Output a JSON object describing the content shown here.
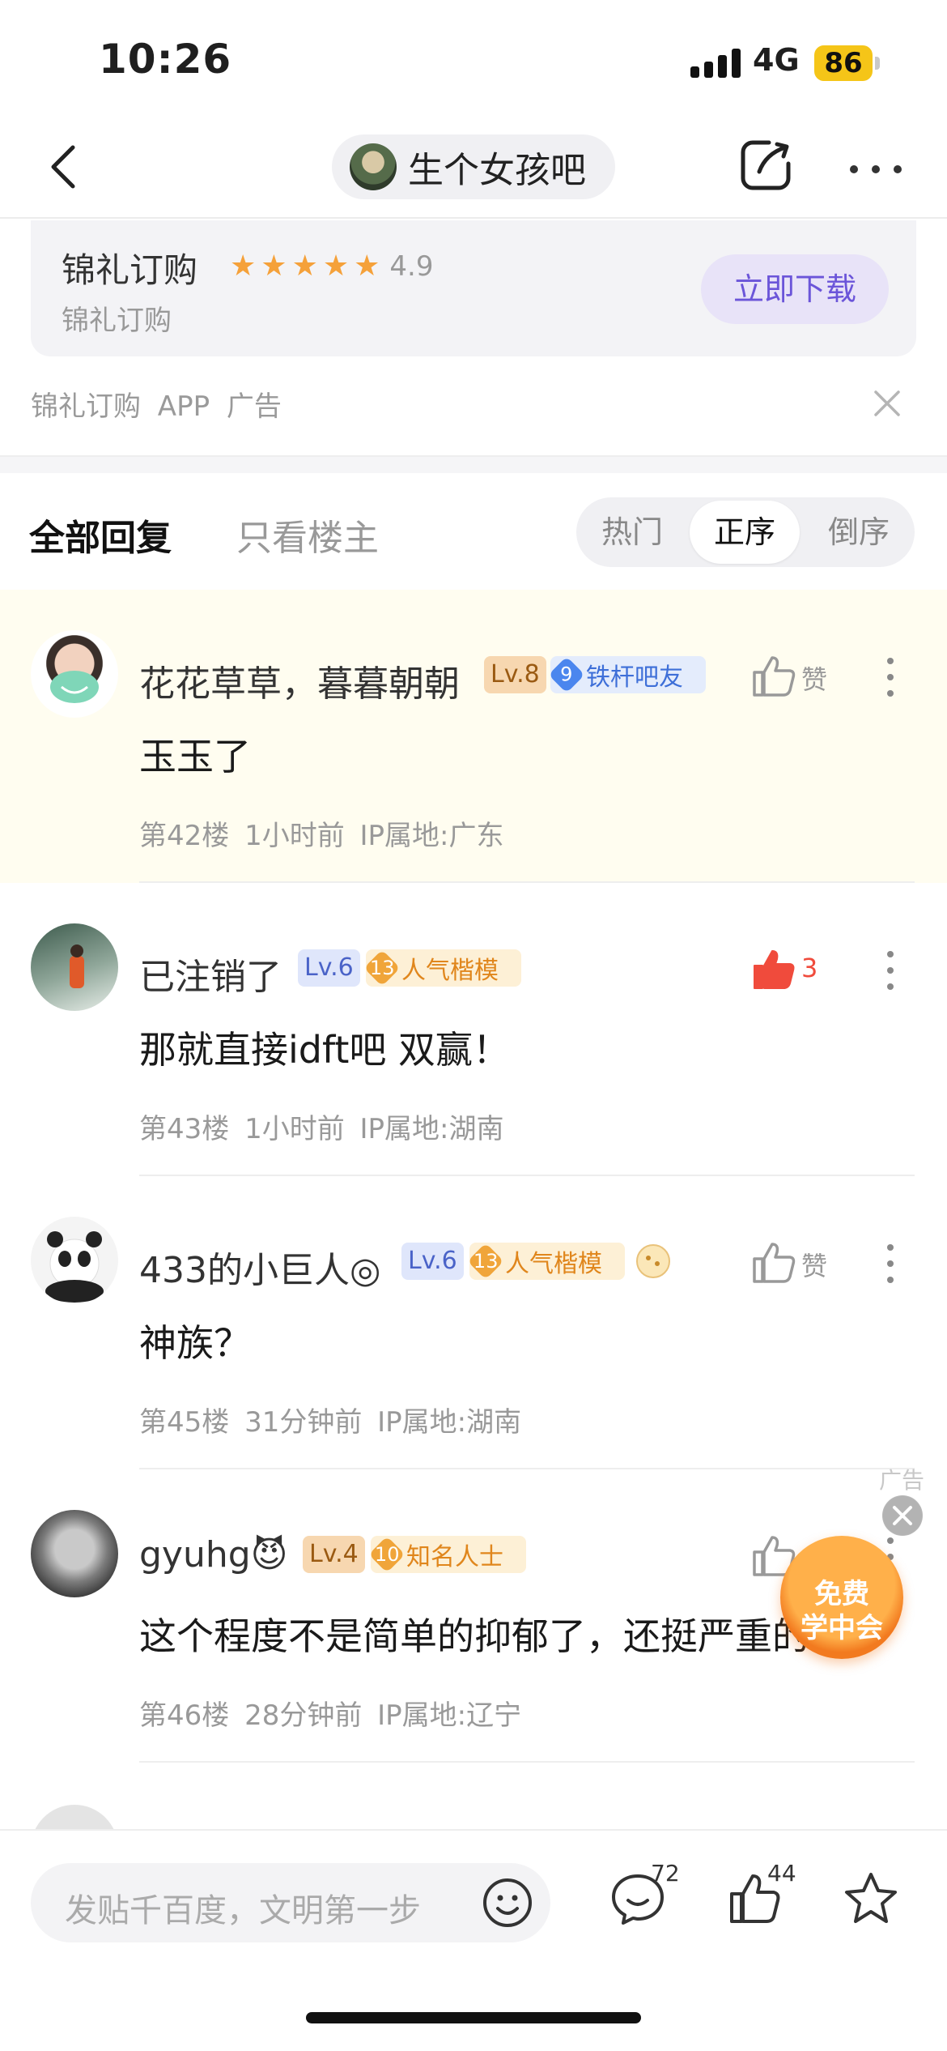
{
  "status_bar": {
    "time": "10:26",
    "network": "4G",
    "battery": "86"
  },
  "nav": {
    "forum_name": "生个女孩吧"
  },
  "ad": {
    "title": "锦礼订购",
    "rating": "4.9",
    "stars": 5,
    "subtitle": "锦礼订购",
    "download_label": "立即下载",
    "meta": "锦礼订购  APP  广告"
  },
  "tabs": {
    "all": "全部回复",
    "op_only": "只看楼主",
    "sort": [
      "热门",
      "正序",
      "倒序"
    ],
    "sort_selected": "正序"
  },
  "posts": [
    {
      "username": "花花草草，暮暮朝朝",
      "level": "Lv.8",
      "badge_num": "9",
      "badge_label": "铁杆吧友",
      "badge_style": "blue",
      "like_label": "赞",
      "content": "玉玉了",
      "floor": "第42楼",
      "time": "1小时前",
      "ip": "IP属地:广东"
    },
    {
      "username": "已注销了",
      "level": "Lv.6",
      "badge_num": "13",
      "badge_label": "人气楷模",
      "badge_style": "orange",
      "like_label": "3",
      "content": "那就直接idft吧 双赢！",
      "floor": "第43楼",
      "time": "1小时前",
      "ip": "IP属地:湖南"
    },
    {
      "username": "433的小巨人◎",
      "level": "Lv.6",
      "badge_num": "13",
      "badge_label": "人气楷模",
      "badge_style": "orange",
      "like_label": "赞",
      "content": "神族？",
      "floor": "第45楼",
      "time": "31分钟前",
      "ip": "IP属地:湖南"
    },
    {
      "username": "gyuhg😈",
      "level": "Lv.4",
      "badge_num": "10",
      "badge_label": "知名人士",
      "badge_style": "orange",
      "like_label": "",
      "content": "这个程度不是简单的抑郁了，还挺严重的",
      "floor": "第46楼",
      "time": "28分钟前",
      "ip": "IP属地:辽宁"
    }
  ],
  "float_ad": {
    "label": "广告",
    "line1": "免费",
    "line2": "学中会"
  },
  "bottom_bar": {
    "reply_placeholder": "发贴千百度，文明第一步",
    "comment_count": "72",
    "like_count": "44"
  }
}
